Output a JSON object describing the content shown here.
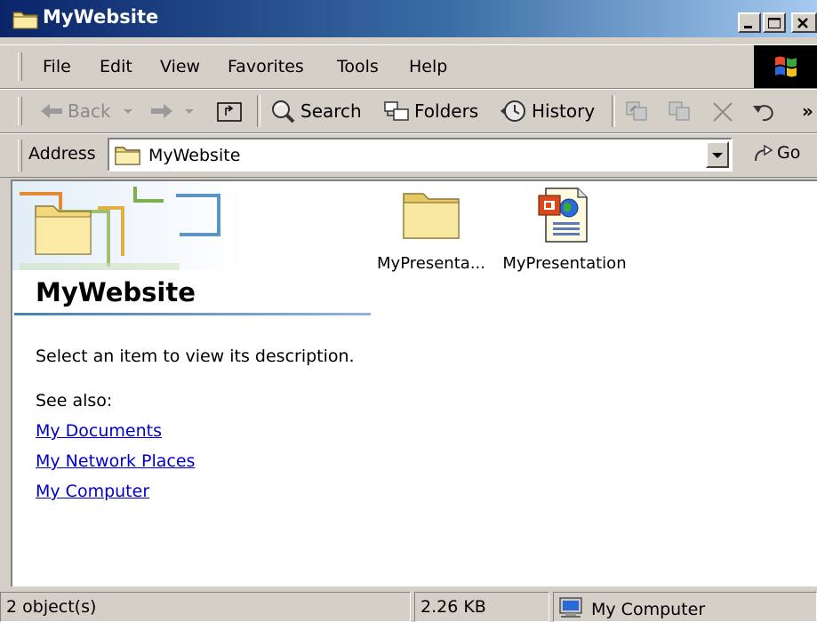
{
  "window": {
    "title": "MyWebsite",
    "minimize_label": "_",
    "maximize_label": "□",
    "close_label": "X"
  },
  "menu": [
    "File",
    "Edit",
    "View",
    "Favorites",
    "Tools",
    "Help"
  ],
  "toolbar": {
    "back": "Back",
    "search": "Search",
    "folders": "Folders",
    "history": "History",
    "overflow": "»"
  },
  "address": {
    "label": "Address",
    "value": "MyWebsite",
    "go": "Go"
  },
  "left_panel": {
    "title": "MyWebsite",
    "description": "Select an item to view its description.",
    "see_also": "See also:",
    "links": [
      "My Documents",
      "My Network Places",
      "My Computer"
    ]
  },
  "files": [
    {
      "name": "MyPresenta...",
      "icon": "folder-icon"
    },
    {
      "name": "MyPresentation",
      "icon": "powerpoint-web-file-icon"
    }
  ],
  "status": {
    "objects": "2 object(s)",
    "size": "2.26 KB",
    "zone": "My Computer"
  },
  "colors": {
    "title_bar": "#0a246a",
    "chrome": "#d4d0c8",
    "link": "#0000cc",
    "folder": "#f5e08a"
  }
}
